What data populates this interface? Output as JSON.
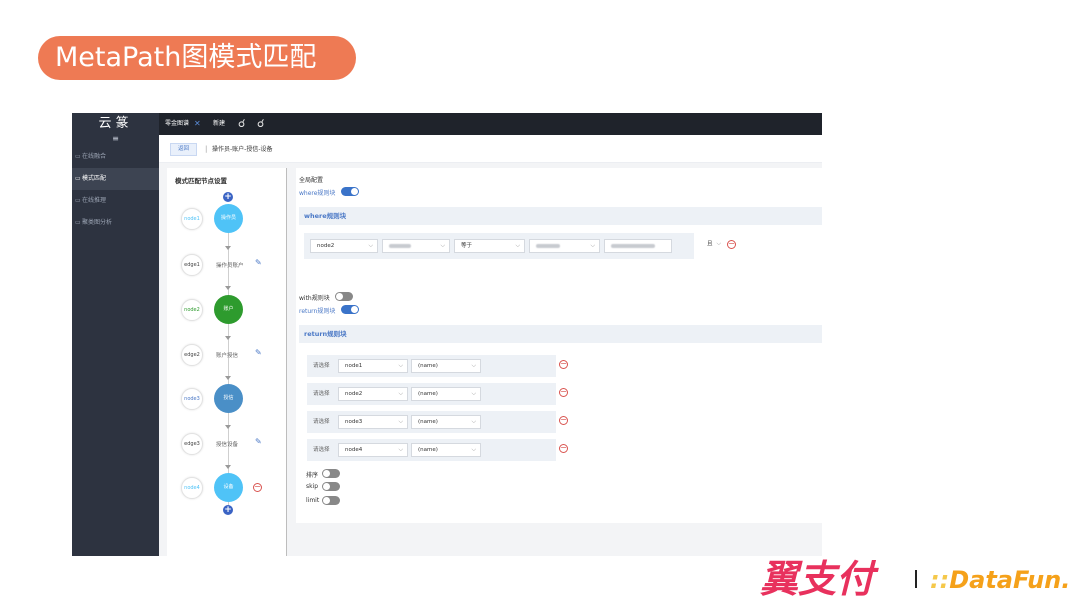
{
  "slide_title": "MetaPath图模式匹配",
  "app": {
    "logo_text": "云篆",
    "menu_icon": "≡",
    "sidebar_items": [
      {
        "label": "在线融合",
        "icon": "sidebar-icon"
      },
      {
        "label": "模式匹配",
        "icon": "sidebar-icon",
        "active": true
      },
      {
        "label": "在线推理",
        "icon": "sidebar-icon"
      },
      {
        "label": "聚类图分析",
        "icon": "sidebar-icon"
      }
    ],
    "topbar": {
      "tab_label": "零金图谱",
      "close_glyph": "✕",
      "new_label": "新建",
      "icon1": "user-link-icon",
      "icon2": "user-x-icon"
    },
    "crumbbar": {
      "back_label": "返回",
      "sep": "|",
      "path": "操作员-账户-授信-设备"
    }
  },
  "left_panel": {
    "title": "模式匹配节点设置",
    "nodes": [
      {
        "pill": "node1",
        "circle": "操作员",
        "color": "#4fc3f7",
        "pill_color": "#4fc3f7"
      },
      {
        "pill": "node2",
        "circle": "账户",
        "color": "#2e9b2e",
        "pill_color": "#2e9b2e"
      },
      {
        "pill": "node3",
        "circle": "授信",
        "color": "#4a8fc7",
        "pill_color": "#4a78c6"
      },
      {
        "pill": "node4",
        "circle": "设备",
        "color": "#4fc3f7",
        "pill_color": "#4fc3f7"
      }
    ],
    "edges": [
      {
        "pill": "edge1",
        "label": "操作员账户"
      },
      {
        "pill": "edge2",
        "label": "账户授信"
      },
      {
        "pill": "edge3",
        "label": "授信设备"
      }
    ],
    "plus_glyph": "+",
    "minus_glyph": "−",
    "pen_glyph": "✎"
  },
  "right_panel": {
    "global_config": "全局配置",
    "where_toggle_label": "where规则块",
    "where_toggle_on": true,
    "where_section": "where规则块",
    "where_row": {
      "field1": "node2",
      "operator": "等于",
      "logic": "且",
      "chevron": "⌵"
    },
    "with_toggle_label": "with规则块",
    "with_toggle_on": false,
    "return_toggle_label": "return规则块",
    "return_toggle_on": true,
    "return_section": "return规则块",
    "return_rows": [
      {
        "label": "请选择",
        "node": "node1",
        "prop": "(name)"
      },
      {
        "label": "请选择",
        "node": "node2",
        "prop": "(name)"
      },
      {
        "label": "请选择",
        "node": "node3",
        "prop": "(name)"
      },
      {
        "label": "请选择",
        "node": "node4",
        "prop": "(name)"
      }
    ],
    "sort_label": "排序",
    "skip_label": "skip",
    "limit_label": "limit"
  },
  "footer": {
    "brand1": "翼支付",
    "brand2_prefix": "::",
    "brand2": "DataFun."
  }
}
